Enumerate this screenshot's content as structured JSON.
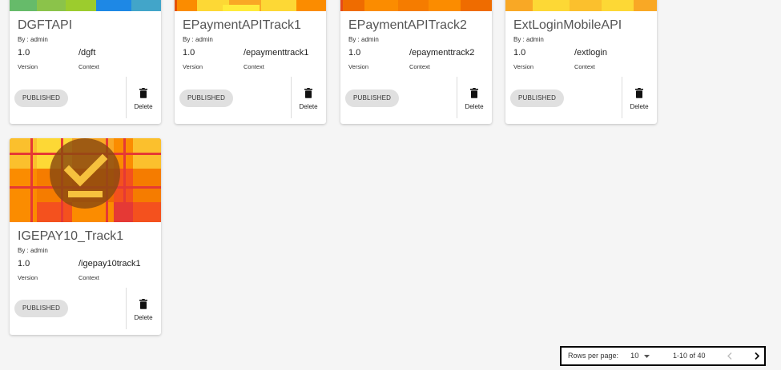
{
  "cards": [
    {
      "title": "DGFTAPI",
      "by": "By : admin",
      "version": "1.0",
      "version_label": "Version",
      "context": "/dgft",
      "context_label": "Context",
      "status": "PUBLISHED",
      "delete_label": "Delete"
    },
    {
      "title": "EPaymentAPITrack1",
      "by": "By : admin",
      "version": "1.0",
      "version_label": "Version",
      "context": "/epaymenttrack1",
      "context_label": "Context",
      "status": "PUBLISHED",
      "delete_label": "Delete"
    },
    {
      "title": "EPaymentAPITrack2",
      "by": "By : admin",
      "version": "1.0",
      "version_label": "Version",
      "context": "/epaymenttrack2",
      "context_label": "Context",
      "status": "PUBLISHED",
      "delete_label": "Delete"
    },
    {
      "title": "ExtLoginMobileAPI",
      "by": "By : admin",
      "version": "1.0",
      "version_label": "Version",
      "context": "/extlogin",
      "context_label": "Context",
      "status": "PUBLISHED",
      "delete_label": "Delete"
    },
    {
      "title": "IGEPAY10_Track1",
      "by": "By : admin",
      "version": "1.0",
      "version_label": "Version",
      "context": "/igepay10track1",
      "context_label": "Context",
      "status": "PUBLISHED",
      "delete_label": "Delete"
    }
  ],
  "icons": {
    "delete": "trash-icon",
    "thumbnail_badge": "checkmark-badge-icon",
    "dropdown": "caret-down-icon",
    "prev": "chevron-left-icon",
    "next": "chevron-right-icon"
  },
  "colors": {
    "chip_bg": "#e0e0e0",
    "thumb_orange": "#fb8c00",
    "thumb_yellow": "#fbc02d",
    "thumb_red": "#e53935"
  },
  "pagination": {
    "rows_label": "Rows per page:",
    "rows_value": "10",
    "range_text": "1-10 of 40"
  }
}
